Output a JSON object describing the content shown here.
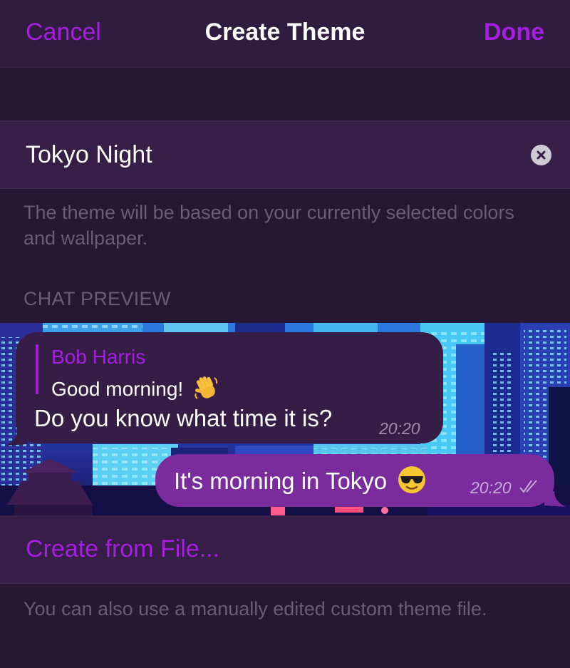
{
  "nav": {
    "cancel_label": "Cancel",
    "title": "Create Theme",
    "done_label": "Done"
  },
  "theme_name": {
    "value": "Tokyo Night",
    "description": "The theme will be based on your currently selected colors and wallpaper."
  },
  "chat_preview": {
    "header": "CHAT PREVIEW",
    "incoming": {
      "reply_author": "Bob Harris",
      "reply_text": "Good morning!",
      "reply_emoji": "waving-hand-emoji",
      "text": "Do you know what time it is?",
      "time": "20:20"
    },
    "outgoing": {
      "text": "It's morning in Tokyo",
      "emoji": "sunglasses-emoji",
      "time": "20:20",
      "status_icon": "double-check-icon"
    }
  },
  "create_from_file": {
    "label": "Create from File...",
    "description": "You can also use a manually edited custom theme file."
  },
  "colors": {
    "accent": "#a51fe0",
    "background": "#271734",
    "cell": "#371e47",
    "incoming_bubble": "#361d46",
    "outgoing_bubble": "#7a2c9c"
  }
}
